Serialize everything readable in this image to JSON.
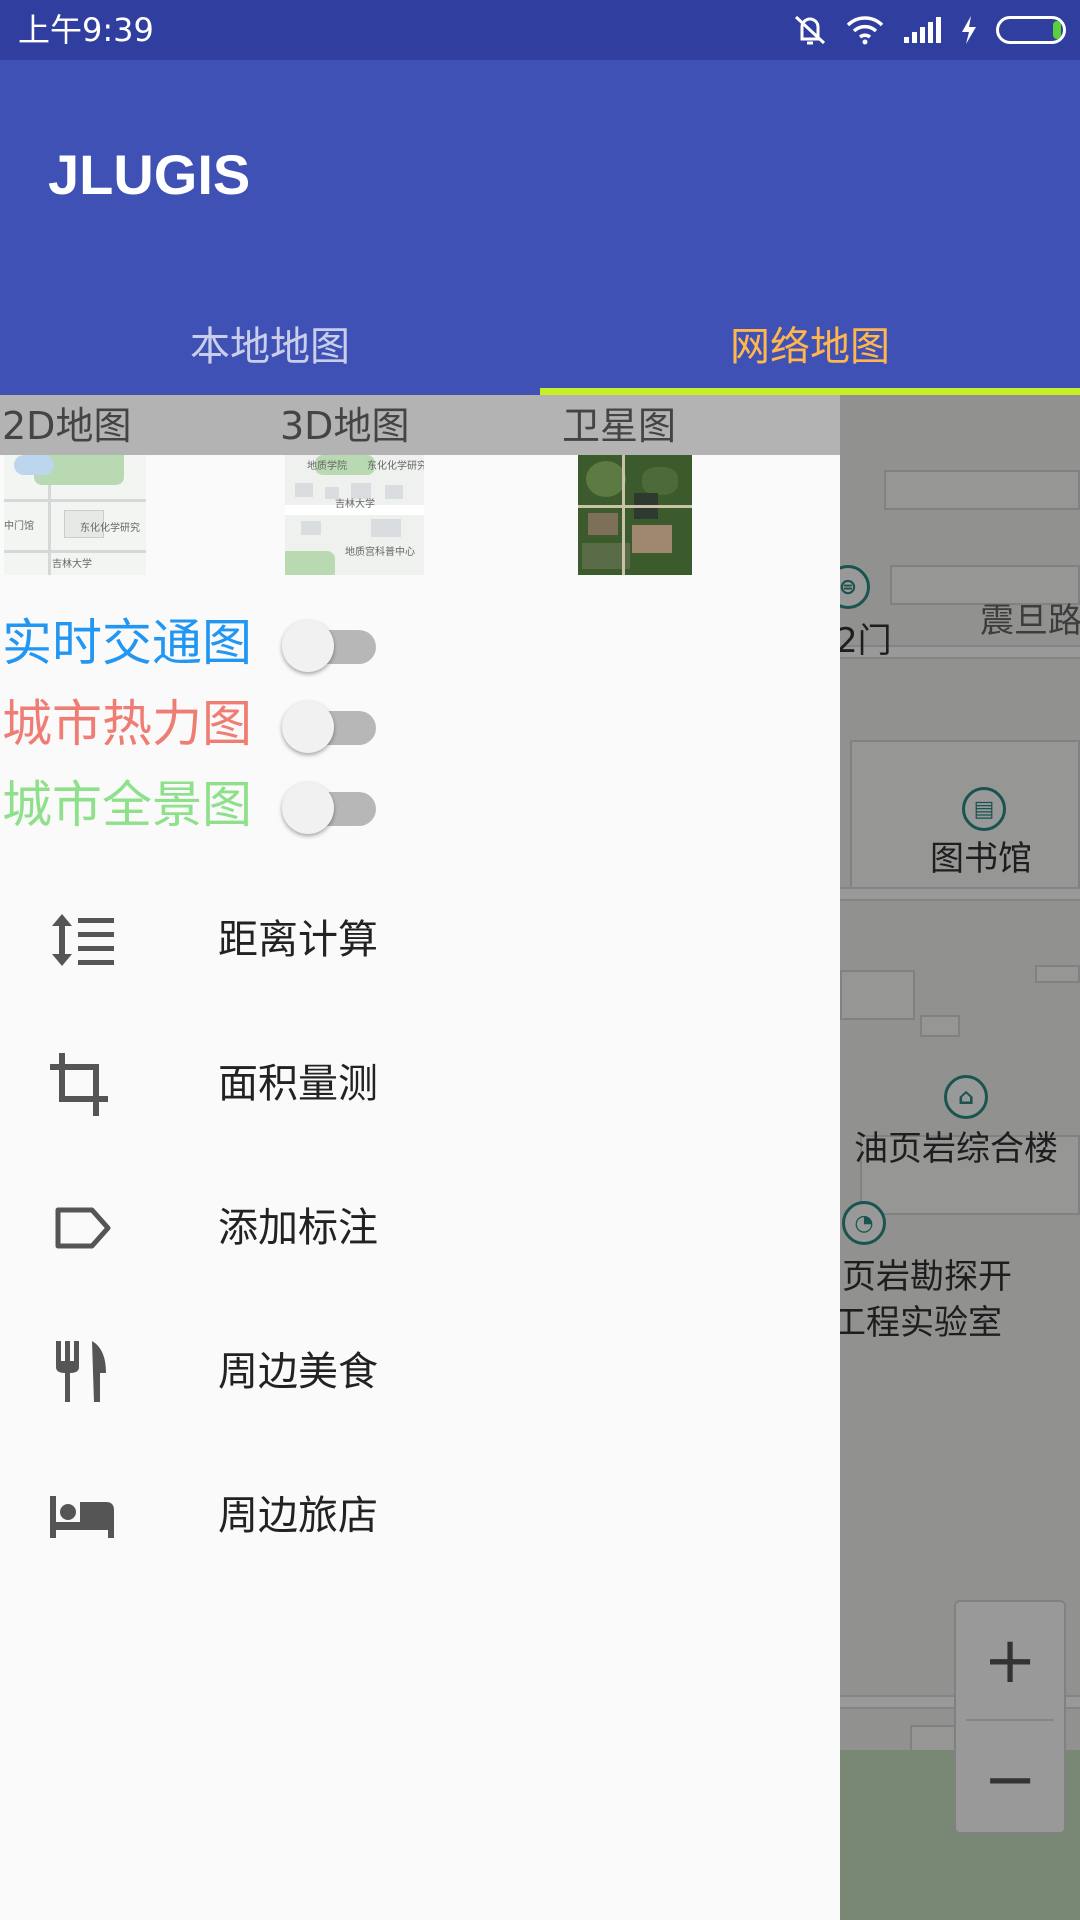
{
  "status_bar": {
    "time": "上午9:39"
  },
  "app_bar": {
    "title": "JLUGIS",
    "tabs": [
      {
        "label": "本地地图",
        "active": false
      },
      {
        "label": "网络地图",
        "active": true
      }
    ],
    "colors": {
      "primary": "#3f51b5",
      "status": "#303f9f",
      "active_tab": "#ffb74d",
      "indicator": "#c6ef2a"
    }
  },
  "drawer": {
    "map_types": [
      {
        "label": "2D地图"
      },
      {
        "label": "3D地图"
      },
      {
        "label": "卫星图"
      }
    ],
    "thumbnails": {
      "2d_texts": [
        "中门馆",
        "东化化学研究",
        "吉林大学"
      ],
      "3d_texts": [
        "地质学院",
        "东化化学研究",
        "吉林大学",
        "地质宫科普中心"
      ]
    },
    "toggles": [
      {
        "label": "实时交通图",
        "color": "#2196f3",
        "on": false
      },
      {
        "label": "城市热力图",
        "color": "#ef7d74",
        "on": false
      },
      {
        "label": "城市全景图",
        "color": "#8ee08a",
        "on": false
      }
    ],
    "menu": [
      {
        "label": "距离计算",
        "icon": "line-spacing-icon"
      },
      {
        "label": "面积量测",
        "icon": "crop-icon"
      },
      {
        "label": "添加标注",
        "icon": "label-icon"
      },
      {
        "label": "周边美食",
        "icon": "restaurant-icon"
      },
      {
        "label": "周边旅店",
        "icon": "hotel-bed-icon"
      }
    ]
  },
  "map": {
    "labels": [
      "震旦路",
      "2门",
      "图书馆",
      "油页岩综合楼",
      "页岩勘探开",
      "工程实验室"
    ],
    "zoom_in": "+",
    "zoom_out": "−"
  }
}
